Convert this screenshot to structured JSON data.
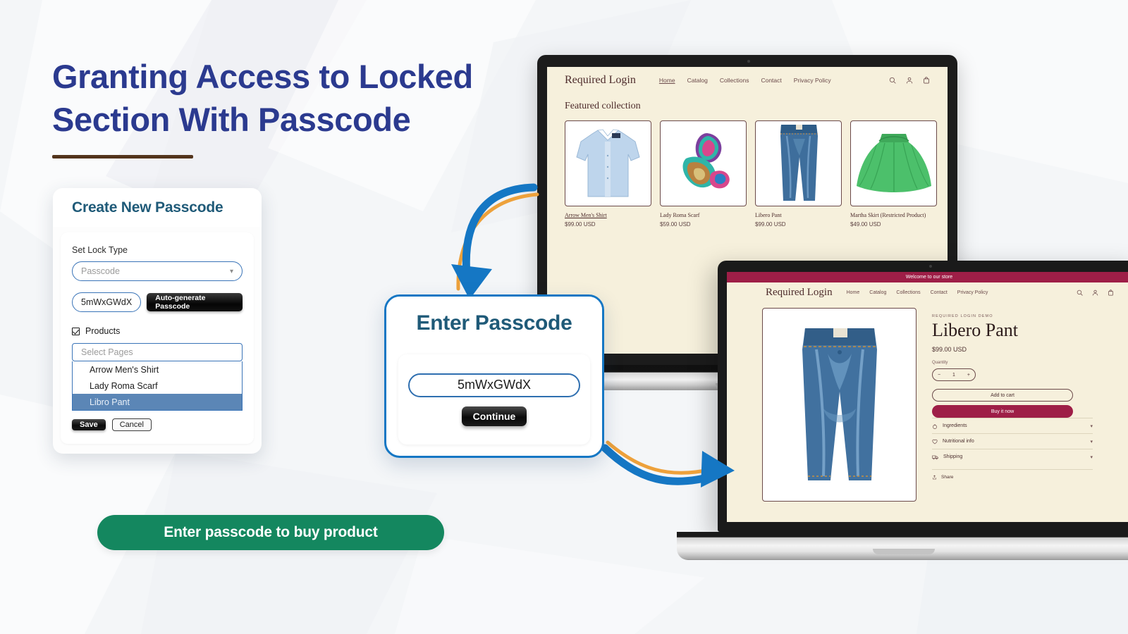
{
  "headline": {
    "text": "Granting Access to Locked Section With Passcode",
    "color": "#2b3a8f",
    "rule_color": "#53341c"
  },
  "create_passcode_card": {
    "title": "Create New Passcode",
    "title_color": "#1f5a78",
    "lock_type_label": "Set Lock Type",
    "lock_type_value": "Passcode",
    "chevron_icon": "chevron-down-icon",
    "passcode_value": "5mWxGWdX",
    "autogenerate_label": "Auto-generate Passcode",
    "products_checkbox_label": "Products",
    "products_checked": true,
    "select_pages_placeholder": "Select Pages",
    "options": [
      {
        "label": "Arrow Men's Shirt",
        "selected": false
      },
      {
        "label": "Lady Roma Scarf",
        "selected": false
      },
      {
        "label": "Libro Pant",
        "selected": true
      }
    ],
    "save_label": "Save",
    "cancel_label": "Cancel"
  },
  "enter_passcode_modal": {
    "title": "Enter Passcode",
    "title_color": "#1f5a78",
    "border_color": "#1577c4",
    "code_value": "5mWxGWdX",
    "continue_label": "Continue"
  },
  "cta": {
    "label": "Enter passcode to buy product",
    "color": "#14875f"
  },
  "storefront_collection": {
    "brand": "Required Login",
    "nav": [
      {
        "label": "Home",
        "active": true
      },
      {
        "label": "Catalog",
        "active": false
      },
      {
        "label": "Collections",
        "active": false
      },
      {
        "label": "Contact",
        "active": false
      },
      {
        "label": "Privacy Policy",
        "active": false
      }
    ],
    "icons": [
      "search-icon",
      "account-icon",
      "cart-icon"
    ],
    "section_title": "Featured collection",
    "products": [
      {
        "name": "Arrow Men's Shirt",
        "price": "$99.00 USD",
        "underline": true,
        "image": "dress-shirt"
      },
      {
        "name": "Lady Roma Scarf",
        "price": "$59.00 USD",
        "underline": false,
        "image": "silk-scarf"
      },
      {
        "name": "Libero Pant",
        "price": "$99.00 USD",
        "underline": false,
        "image": "blue-jeans"
      },
      {
        "name": "Martha Skirt (Restricted Product)",
        "price": "$49.00 USD",
        "underline": false,
        "image": "green-skirt"
      }
    ]
  },
  "storefront_product": {
    "announcement": "Welcome to our store",
    "announcement_color": "#9e1e47",
    "brand": "Required Login",
    "nav": [
      {
        "label": "Home"
      },
      {
        "label": "Catalog"
      },
      {
        "label": "Collections"
      },
      {
        "label": "Contact"
      },
      {
        "label": "Privacy Policy"
      }
    ],
    "icons": [
      "search-icon",
      "account-icon",
      "cart-icon"
    ],
    "vendor": "REQUIRED LOGIN DEMO",
    "product_title": "Libero Pant",
    "price": "$99.00 USD",
    "quantity_label": "Quantity",
    "quantity_minus": "−",
    "quantity_value": "1",
    "quantity_plus": "+",
    "add_to_cart_label": "Add to cart",
    "buy_now_label": "Buy it now",
    "accordions": [
      {
        "label": "Ingredients",
        "icon": "apple-icon"
      },
      {
        "label": "Nutritional info",
        "icon": "heart-icon"
      },
      {
        "label": "Shipping",
        "icon": "truck-icon"
      }
    ],
    "share_label": "Share",
    "share_icon": "share-icon"
  },
  "arrows": {
    "blue": "#1577c4",
    "orange": "#eda13b"
  }
}
